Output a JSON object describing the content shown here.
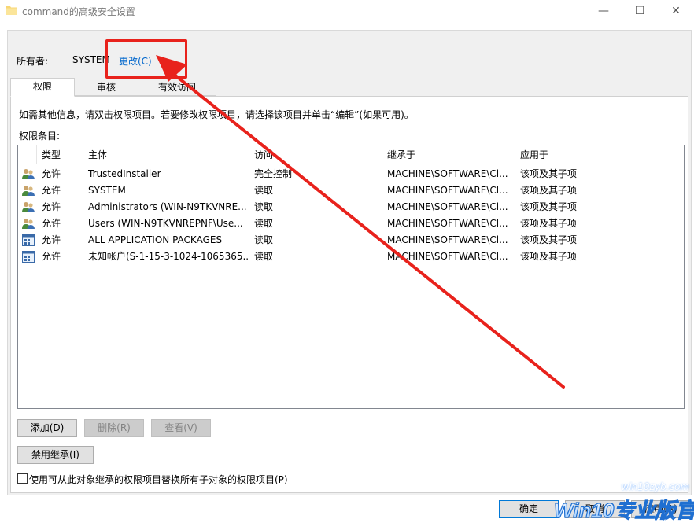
{
  "window": {
    "title": "command的高级安全设置",
    "controls": {
      "minimize": "—",
      "maximize": "☐",
      "close": "✕"
    }
  },
  "owner": {
    "label": "所有者:",
    "value": "SYSTEM",
    "change_link": "更改(C)"
  },
  "tabs": [
    {
      "label": "权限",
      "active": true
    },
    {
      "label": "审核",
      "active": false
    },
    {
      "label": "有效访问",
      "active": false
    }
  ],
  "info_text": "如需其他信息，请双击权限项目。若要修改权限项目，请选择该项目并单击“编辑”(如果可用)。",
  "entries_label": "权限条目:",
  "table": {
    "columns": [
      "类型",
      "主体",
      "访问",
      "继承于",
      "应用于"
    ],
    "rows": [
      {
        "icon": "user-group-icon",
        "type": "允许",
        "principal": "TrustedInstaller",
        "access": "完全控制",
        "inherited": "MACHINE\\SOFTWARE\\Cl...",
        "applies": "该项及其子项"
      },
      {
        "icon": "user-group-icon",
        "type": "允许",
        "principal": "SYSTEM",
        "access": "读取",
        "inherited": "MACHINE\\SOFTWARE\\Cl...",
        "applies": "该项及其子项"
      },
      {
        "icon": "user-group-icon",
        "type": "允许",
        "principal": "Administrators (WIN-N9TKVNRE...",
        "access": "读取",
        "inherited": "MACHINE\\SOFTWARE\\Cl...",
        "applies": "该项及其子项"
      },
      {
        "icon": "user-group-icon",
        "type": "允许",
        "principal": "Users (WIN-N9TKVNREPNF\\Use...",
        "access": "读取",
        "inherited": "MACHINE\\SOFTWARE\\Cl...",
        "applies": "该项及其子项"
      },
      {
        "icon": "app-package-icon",
        "type": "允许",
        "principal": "ALL APPLICATION PACKAGES",
        "access": "读取",
        "inherited": "MACHINE\\SOFTWARE\\Cl...",
        "applies": "该项及其子项"
      },
      {
        "icon": "app-package-icon",
        "type": "允许",
        "principal": "未知帐户(S-1-15-3-1024-1065365...",
        "access": "读取",
        "inherited": "MACHINE\\SOFTWARE\\Cl...",
        "applies": "该项及其子项"
      }
    ]
  },
  "buttons": {
    "add": "添加(D)",
    "remove": "删除(R)",
    "view": "查看(V)",
    "disable_inheritance": "禁用继承(I)",
    "ok": "确定",
    "cancel": "取消",
    "apply": "应用(A)"
  },
  "checkbox": {
    "label": "使用可从此对象继承的权限项目替换所有子对象的权限项目(P)",
    "checked": false
  },
  "watermark": {
    "url": "win10zyb.com",
    "brand": "Win10专业版官网"
  },
  "colors": {
    "link": "#0066cc",
    "annotation": "#e8221c",
    "accent": "#0078d7"
  }
}
